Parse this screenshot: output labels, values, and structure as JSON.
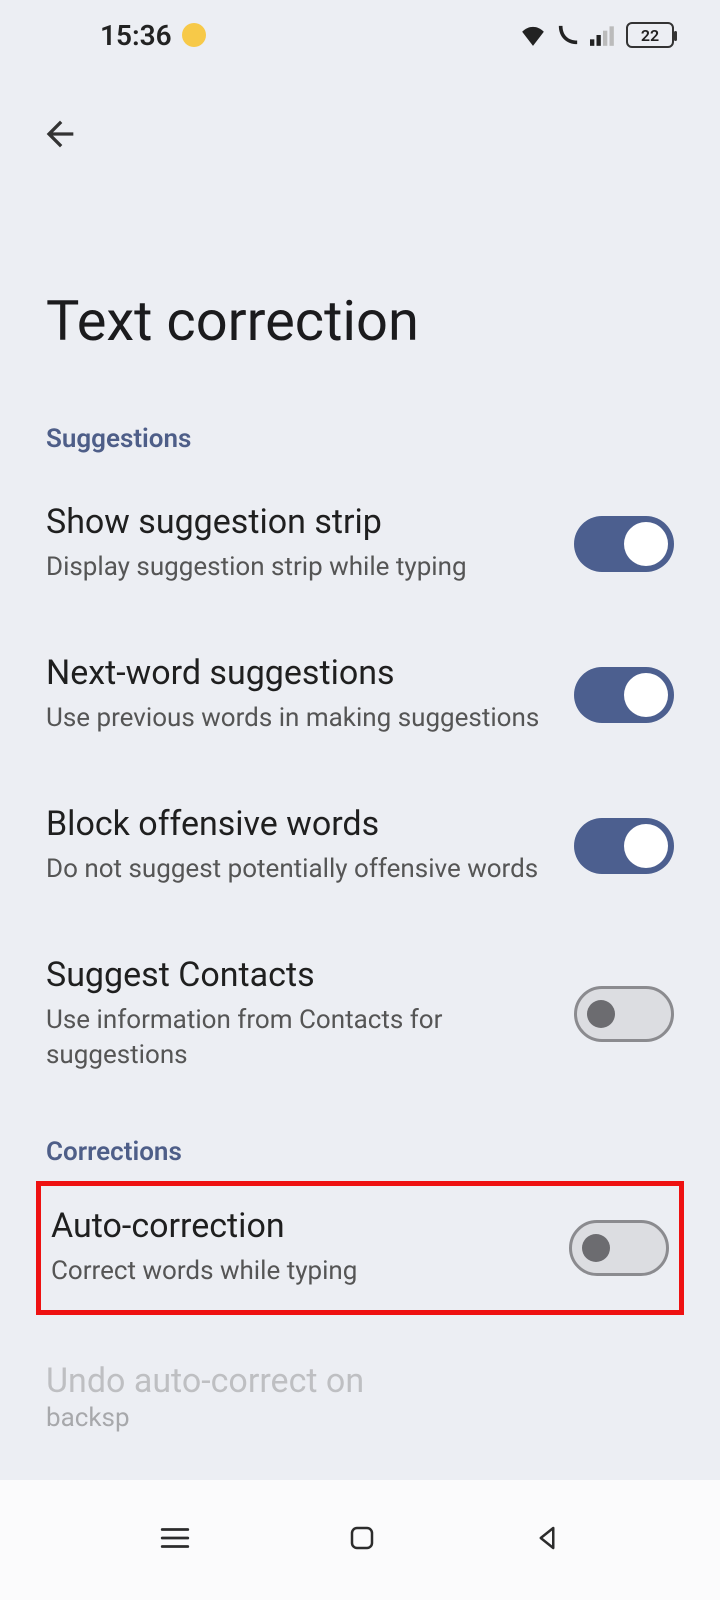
{
  "status": {
    "time": "15:36",
    "battery": "22"
  },
  "pageTitle": "Text correction",
  "sections": {
    "suggestions": {
      "label": "Suggestions",
      "rows": [
        {
          "title": "Show suggestion strip",
          "sub": "Display suggestion strip while typing",
          "on": true
        },
        {
          "title": "Next-word suggestions",
          "sub": "Use previous words in making suggestions",
          "on": true
        },
        {
          "title": "Block offensive words",
          "sub": "Do not suggest potentially offensive words",
          "on": true
        },
        {
          "title": "Suggest Contacts",
          "sub": "Use information from Contacts for suggestions",
          "on": false
        }
      ]
    },
    "corrections": {
      "label": "Corrections",
      "rows": [
        {
          "title": "Auto-correction",
          "sub": "Correct words while typing",
          "on": false
        }
      ],
      "partial": {
        "title": "Undo auto-correct on",
        "sub": "backsp"
      }
    }
  }
}
